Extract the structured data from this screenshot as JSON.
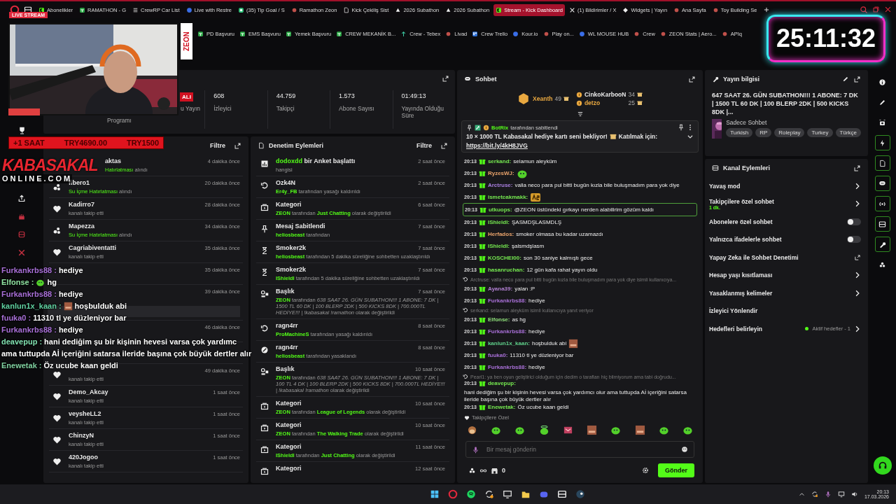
{
  "browser": {
    "tabs": [
      {
        "label": "Abonelikler",
        "selected": false
      },
      {
        "label": "RAMATHON - G",
        "selected": false
      },
      {
        "label": "CrewRP Car List",
        "selected": false
      },
      {
        "label": "Live with Restre",
        "selected": false
      },
      {
        "label": "(35) Tip Goal / S",
        "selected": false
      },
      {
        "label": "Ramathon Zeon",
        "selected": false
      },
      {
        "label": "Kick Çekiliş Sist",
        "selected": false
      },
      {
        "label": "2026 Subathon",
        "selected": false
      },
      {
        "label": "2026 Subathon",
        "selected": false
      },
      {
        "label": "Stream - Kick Dashboard",
        "selected": true
      },
      {
        "label": "(1) Bildirimler / X",
        "selected": false
      },
      {
        "label": "Widgets | Yayın",
        "selected": false
      },
      {
        "label": "Ana Sayfa",
        "selected": false
      },
      {
        "label": "Toy Building Se",
        "selected": false
      }
    ],
    "bookmarks": [
      "PD Başvuru",
      "EMS Başvuru",
      "Yemek Başvuru",
      "CREW MEKANİK B...",
      "Crew - Tebex",
      "Livad",
      "Crew Trello",
      "Kour.io",
      "Play on...",
      "WL MOUSE HUB",
      "Crew",
      "ZEON Stats | Aero...",
      "APIq"
    ]
  },
  "overlay": {
    "live_badge": "LIVE STREAM",
    "brand_label": "ZEON",
    "timer": "25:11:32",
    "sub_bar": [
      "+1 SAAT",
      "TRY4690.00",
      "TRY1500"
    ],
    "logo": {
      "main": "KABASAKAL",
      "sub": "ONLINE.COM"
    },
    "chat": [
      {
        "kind": "message",
        "user": "Furkankrbs88 :",
        "color": "#a970d8",
        "text": "hediye"
      },
      {
        "kind": "message_emote",
        "user": "Elfonse :",
        "color": "#8fe0a0",
        "text": "hg"
      },
      {
        "kind": "message",
        "user": "Furkankrbs88 :",
        "color": "#a970d8",
        "text": "hediye"
      },
      {
        "kind": "message_emote",
        "user": "kanlun1x_kaan :",
        "color": "#60d0a0",
        "text": "hoşbulduk abi"
      },
      {
        "kind": "message",
        "user": "fuuka0 :",
        "color": "#a970d8",
        "text": "11310 tl ye düzleniyor bar"
      },
      {
        "kind": "message",
        "user": "Furkankrbs88 :",
        "color": "#a970d8",
        "text": "hediye"
      },
      {
        "kind": "message",
        "user": "deavepup :",
        "color": "#80e0b0",
        "text": "hani dediğim şu bir kişinin hevesi varsa çok yardımc",
        "more": "ama tuttupda Aİ içeriğini satarsa ileride başına çok büyük dertler alır"
      },
      {
        "kind": "message",
        "user": "Enewetak :",
        "color": "#80d0a0",
        "text": "Öz ucube kaan geldi"
      }
    ]
  },
  "stats": {
    "partial_badge": "ALI",
    "partial_label": "u Yayın",
    "partial_sub": "Programı",
    "items": [
      {
        "value": "608",
        "label": "İzleyici"
      },
      {
        "value": "44.759",
        "label": "Takipçi"
      },
      {
        "value": "1.573",
        "label": "Abone Sayısı"
      },
      {
        "value": "01:49:13",
        "label": "Yayında Olduğu Süre"
      }
    ]
  },
  "activity": {
    "filter": "Filtre",
    "rows": [
      {
        "kind": "drops",
        "name": "aktas",
        "detail": "**Hatırlatması** alındı",
        "time": "4 dakika önce"
      },
      {
        "kind": "drops",
        "name": "fibero1",
        "detail": "**Su İçme Hatırlatması** alındı",
        "time": "20 dakika önce"
      },
      {
        "kind": "follow",
        "name": "Kadirro7",
        "detail": "kanalı takip etti",
        "time": "28 dakika önce"
      },
      {
        "kind": "drops",
        "name": "Mapezza",
        "detail": "**Su İçme Hatırlatması** alındı",
        "time": "34 dakika önce"
      },
      {
        "kind": "follow",
        "name": "Cagriabiventatti",
        "detail": "kanalı takip etti",
        "time": "35 dakika önce"
      },
      {
        "kind": "follow",
        "time": "35 dakika önce"
      },
      {
        "kind": "resub",
        "time": "39 dakika önce"
      },
      {
        "kind": "follow",
        "time": "46 dakika önce"
      },
      {
        "kind": "sub"
      },
      {
        "kind": "follow",
        "detail": "kanalı takip etti",
        "time": "49 dakika önce"
      },
      {
        "kind": "follow",
        "name": "Demo_Akcay",
        "detail": "kanalı takip etti",
        "time": "1 saat önce"
      },
      {
        "kind": "follow",
        "name": "veysheLL2",
        "detail": "kanalı takip etti",
        "time": "1 saat önce"
      },
      {
        "kind": "follow",
        "name": "ChinzyN",
        "detail": "kanalı takip etti",
        "time": "1 saat önce"
      },
      {
        "kind": "follow",
        "name": "420Jogoo",
        "detail": "kanalı takip etti",
        "time": "1 saat önce"
      }
    ]
  },
  "moderation": {
    "title": "Denetim Eylemleri",
    "filter": "Filtre",
    "rows": [
      {
        "kind": "poll",
        "title": "**dodoxdd** bir Anket başlattı",
        "detail": "hangisi",
        "time": "2 saat önce"
      },
      {
        "kind": "unban",
        "title": "Ozk4N",
        "detail": "**Er4y_FB** tarafından yasağı kaldırıldı",
        "time": "2 saat önce"
      },
      {
        "kind": "category",
        "title": "Kategori",
        "detail": "**ZEON** tarafından **Just Chatting** olarak değiştirildi",
        "time": "6 saat önce"
      },
      {
        "kind": "pin",
        "title": "Mesaj Sabitlendi",
        "detail": "**heliosbeast** tarafından",
        "time": "7 saat önce"
      },
      {
        "kind": "timeout",
        "title": "Smoker2k",
        "detail": "**heliosbeast** tarafından 5 dakika süreliğine sohbetten uzaklaştırıldı",
        "time": "7 saat önce"
      },
      {
        "kind": "timeout",
        "title": "Smoker2k",
        "detail": "**IShieldI** tarafından 5 dakika süreliğine sohbetten uzaklaştırıldı",
        "time": "7 saat önce"
      },
      {
        "kind": "title",
        "title": "Başlık",
        "detail": "**ZEON** tarafından *638 SAAT 26. GÜN SUBATHON!!! 1 ABONE: 7 DK | 1500 TL 60 DK | 100 BLERP 2DK | 500 KICKS 8DK | 700.000TL HEDİYE!!! | !kabasakal !ramathon* olarak değiştirildi",
        "time": "7 saat önce"
      },
      {
        "kind": "unban",
        "title": "ragn4rr",
        "detail": "**ProMachineS** tarafından yasağı kaldırıldı",
        "time": "8 saat önce"
      },
      {
        "kind": "ban",
        "title": "ragn4rr",
        "detail": "**heliosbeast** tarafından yasaklandı",
        "time": "8 saat önce"
      },
      {
        "kind": "title",
        "title": "Başlık",
        "detail": "**ZEON** tarafından *638 SAAT 26. GÜN SUBATHON!!! 1 ABONE: 7 DK | 100 TL 4 DK | 100 BLERP 2DK | 500 KICKS 8DK | 700.000TL HEDİYE!!! | !kabasakal !ramathon* olarak değiştirildi",
        "time": "10 saat önce"
      },
      {
        "kind": "category",
        "title": "Kategori",
        "detail": "**ZEON** tarafından **League of Legends** olarak değiştirildi",
        "time": "10 saat önce"
      },
      {
        "kind": "category",
        "title": "Kategori",
        "detail": "**ZEON** tarafından **The Walking Trade** olarak değiştirildi",
        "time": "10 saat önce"
      },
      {
        "kind": "category",
        "title": "Kategori",
        "detail": "**IShieldI** tarafından **Just Chatting** olarak değiştirildi",
        "time": "11 saat önce"
      },
      {
        "kind": "category",
        "title": "Kategori",
        "time": "12 saat önce"
      }
    ]
  },
  "chat": {
    "title": "Sohbet",
    "leaders": [
      {
        "name": "Xeanth",
        "count": "49",
        "color": "#e9a840"
      },
      {
        "name": "CinkoKarbooN",
        "count": "34",
        "color": "#e8e8e8"
      },
      {
        "name": "detzo",
        "count": "25",
        "color": "#e9a840"
      }
    ],
    "pinned": {
      "by": "BotRix",
      "by_text": "tarafından sabitlendi",
      "text": "10 × 1000 TL Kabasakal hediye kartı seni bekliyor!",
      "text_after": "Katılmak için:",
      "link": "https://bit.ly/4kH8JVG"
    },
    "messages": [
      {
        "kind": "message",
        "time": "20:13",
        "user": "serkand:",
        "color": "#75e850",
        "text": "selamun aleyküm"
      },
      {
        "kind": "emote",
        "time": "20:13",
        "user": "RyzesWJ:",
        "color": "#e9a36b"
      },
      {
        "kind": "message",
        "time": "20:13",
        "user": "Arctruse:",
        "color": "#a97fe0",
        "text": "valla neco para pul bitti bugün kızla bile buluşmadım para yok diye"
      },
      {
        "kind": "emote",
        "time": "20:13",
        "user": "ismetcakmakk:",
        "color": "#75e850"
      },
      {
        "kind": "message",
        "time": "20:13",
        "user": "utkuops:",
        "color": "#75e850",
        "text": "@ZEON üstündeki gırkayı nerden alabilirim gözüm kaldı",
        "mention": true
      },
      {
        "kind": "message",
        "time": "20:13",
        "user": "IShieldI:",
        "color": "#75e850",
        "text": "ŞASMDŞLASMDLŞ"
      },
      {
        "kind": "message",
        "time": "20:13",
        "user": "Herfados:",
        "color": "#e9a36b",
        "text": "smoker olmasa bu kadar uzamazdı"
      },
      {
        "kind": "message",
        "time": "20:13",
        "user": "IShieldI:",
        "color": "#75e850",
        "text": "şalsmdşlasm"
      },
      {
        "kind": "message",
        "time": "20:13",
        "user": "KOSCHEI00:",
        "color": "#75e850",
        "text": "son 30 saniye kalmıştı gece"
      },
      {
        "kind": "message",
        "time": "20:13",
        "user": "hasanruchan:",
        "color": "#75e850",
        "text": "12 gün kafa rahat yayın oldu"
      },
      {
        "kind": "reply",
        "text": "Arctruse: valla neco para pul bitti bugün kızla bile buluşmadım para yok diye isimli kullanıcıya..."
      },
      {
        "kind": "message",
        "time": "20:13",
        "user": "Ayana39:",
        "color": "#b07fd0",
        "text": "yalan :P"
      },
      {
        "kind": "message",
        "time": "20:13",
        "user": "Furkankrbs88:",
        "color": "#a970d8",
        "text": "hediye"
      },
      {
        "kind": "reply",
        "text": "serkand: selamun aleyküm isimli kullanıcıya yanıt veriyor"
      },
      {
        "kind": "message",
        "time": "20:13",
        "user": "Elfonse:",
        "color": "#8fe07a",
        "text": "as hg"
      },
      {
        "kind": "message",
        "time": "20:13",
        "user": "Furkankrbs88:",
        "color": "#a970d8",
        "text": "hediye"
      },
      {
        "kind": "message_emote",
        "time": "20:13",
        "user": "kanlun1x_kaan:",
        "color": "#5fd08a",
        "text": "hoşbulduk abi"
      },
      {
        "kind": "message",
        "time": "20:13",
        "user": "fuuka0:",
        "color": "#a970d8",
        "text": "11310 tl ye düzleniyor bar"
      },
      {
        "kind": "message",
        "time": "20:13",
        "user": "Furkankrbs88:",
        "color": "#a970d8",
        "text": "hediye"
      },
      {
        "kind": "reply",
        "text": "Pearl1: ya ben oyun geliştirici olduğum için dedim o tarafları hiç bilmiyorum ama tabi doğrudu..."
      },
      {
        "kind": "message",
        "time": "20:13",
        "user": "deavepup:",
        "color": "#75e850",
        "text": "hani dediğim şu bir kişinin hevesi varsa çok yardımcı olur ama tuttupda Aİ içeriğini satarsa ileride başına çok büyük dertler alır"
      },
      {
        "kind": "message",
        "time": "20:13",
        "user": "Enewetak:",
        "color": "#75e850",
        "text": "Öz ucube kaan geldi"
      }
    ],
    "emote_label": "Takipçilere Özel",
    "input_placeholder": "Bir mesaj gönderin",
    "points": "0",
    "send": "Gönder"
  },
  "stream_info": {
    "title": "Yayın bilgisi",
    "stream_title": "647 SAAT 26. GÜN SUBATHON!!! 1 ABONE: 7 DK | 1500 TL 60 DK | 100 BLERP 2DK | 500 KICKS 8DK |...",
    "category": "Sadece Sohbet",
    "tags": [
      "Turkish",
      "RP",
      "Roleplay",
      "Turkey",
      "Türkçe"
    ]
  },
  "channel_actions": {
    "title": "Kanal Eylemleri",
    "items": [
      {
        "kind": "link",
        "label": "Yavaş mod"
      },
      {
        "kind": "link",
        "label": "Takipçilere özel sohbet",
        "sub": "1 dk."
      },
      {
        "kind": "toggle",
        "label": "Abonelere özel sohbet",
        "on": false
      },
      {
        "kind": "toggle",
        "label": "Yalnızca ifadelerle sohbet",
        "on": false
      },
      {
        "kind": "external",
        "label": "Yapay Zeka ile Sohbet Denetimi"
      },
      {
        "kind": "link",
        "label": "Hesap yaşı kısıtlaması"
      },
      {
        "kind": "link",
        "label": "Yasaklanmış kelimeler"
      },
      {
        "kind": "plain",
        "label": "İzleyici Yönlendir"
      },
      {
        "kind": "link",
        "label": "Hedefleri belirleyin",
        "status": "Aktif hedefler - 1"
      }
    ]
  },
  "right_rail": [
    {
      "active": false
    },
    {
      "active": false
    },
    {
      "active": false
    },
    {
      "active": true
    },
    {
      "active": true
    },
    {
      "active": true
    },
    {
      "active": true
    },
    {
      "active": true
    },
    {
      "active": true
    },
    {
      "active": false
    }
  ],
  "taskbar": {
    "time": "20:13",
    "date": "17.03.2026"
  }
}
